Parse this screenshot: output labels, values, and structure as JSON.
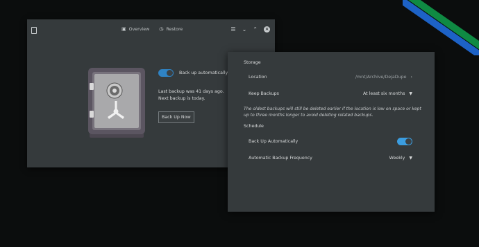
{
  "main_window": {
    "tabs": [
      {
        "label": "Overview",
        "icon": "overview-icon"
      },
      {
        "label": "Restore",
        "icon": "history-icon"
      }
    ],
    "auto_backup_label": "Back up automatically",
    "auto_backup_enabled": true,
    "last_backup": "Last backup was 41 days ago.",
    "next_backup": "Next backup is today.",
    "back_up_now_label": "Back Up Now"
  },
  "preferences": {
    "storage_header": "Storage",
    "location_label": "Location",
    "location_value": "/mnt/Archive/DejaDupe",
    "keep_backups_label": "Keep Backups",
    "keep_backups_value": "At least six months",
    "note": "The oldest backups will still be deleted earlier if the location is low on space or kept up to three months longer to avoid deleting related backups.",
    "schedule_header": "Schedule",
    "auto_label": "Back Up Automatically",
    "auto_enabled": true,
    "frequency_label": "Automatic Backup Frequency",
    "frequency_value": "Weekly"
  },
  "colors": {
    "accent": "#3b9de0",
    "window_bg": "#353a3c",
    "desktop_bg": "#0b0d0d"
  }
}
